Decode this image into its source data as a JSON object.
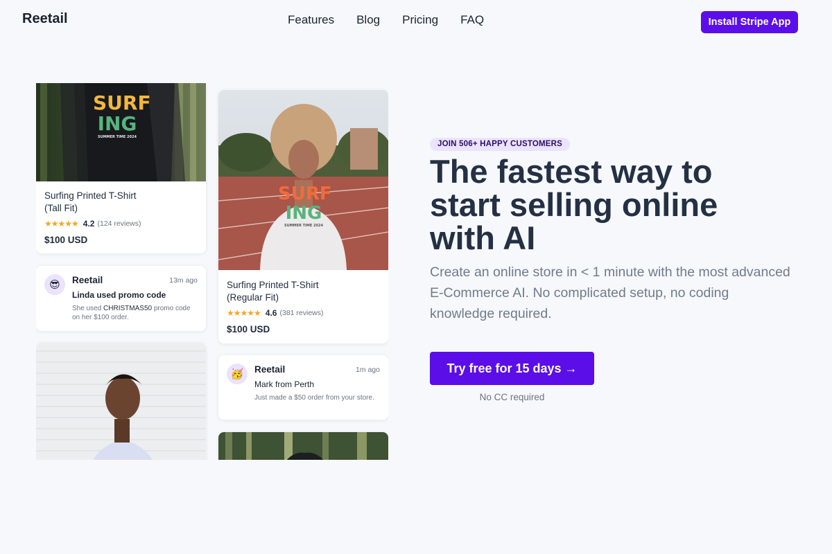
{
  "header": {
    "brand": "Reetail",
    "nav": [
      "Features",
      "Blog",
      "Pricing",
      "FAQ"
    ],
    "install_button": "Install Stripe App"
  },
  "hero": {
    "badge": "JOIN 506+ HAPPY CUSTOMERS",
    "headline": "The fastest way to start selling online with AI",
    "subhead": "Create an online store in < 1 minute with the most advanced E-Commerce AI. No complicated setup, no coding knowledge required.",
    "cta": "Try free for 15 days →",
    "cta_note": "No CC required"
  },
  "products": [
    {
      "title": "Surfing Printed T-Shirt\n(Tall Fit)",
      "stars": "★★★★★",
      "rating": "4.2",
      "reviews": "(124 reviews)",
      "price": "$100 USD",
      "print_top": "SURF",
      "print_bottom": "ING",
      "print_caption": "SUMMER TIME 2024"
    },
    {
      "title": "Surfing Printed T-Shirt\n(Regular Fit)",
      "stars": "★★★★★",
      "rating": "4.6",
      "reviews": "(381 reviews)",
      "price": "$100 USD",
      "print_top": "SURF",
      "print_bottom": "ING",
      "print_caption": "SUMMER TIME 2024"
    }
  ],
  "notifications": [
    {
      "avatar": "😎",
      "brand": "Reetail",
      "time": "13m ago",
      "title": "Linda used promo code",
      "body_prefix": "She used ",
      "body_code": "CHRISTMAS50",
      "body_suffix": " promo code on her $100 order."
    },
    {
      "avatar": "🥳",
      "brand": "Reetail",
      "time": "1m ago",
      "title": "Mark from Perth",
      "body": "Just made a $50 order from your store."
    }
  ],
  "colors": {
    "accent": "#5b0ee8",
    "background": "#f6f8fb",
    "heading": "#243044",
    "badge_bg": "#ece3fc",
    "star": "#f5a623"
  }
}
